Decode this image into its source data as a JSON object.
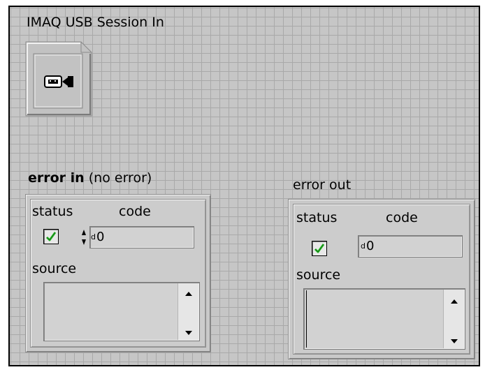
{
  "session": {
    "title": "IMAQ USB Session In",
    "icon": "usb-camera-icon"
  },
  "error_in": {
    "label_bold": "error in",
    "label_suffix": " (no error)",
    "status_label": "status",
    "code_label": "code",
    "status_checked": true,
    "code_radix": "d",
    "code_value": "0",
    "source_label": "source",
    "source_value": ""
  },
  "error_out": {
    "label": "error out",
    "status_label": "status",
    "code_label": "code",
    "status_checked": true,
    "code_radix": "d",
    "code_value": "0",
    "source_label": "source",
    "source_value": ""
  },
  "colors": {
    "panel_bg": "#c6c6c6",
    "grid": "#a9a9a9",
    "check_green": "#2fbf2f"
  }
}
